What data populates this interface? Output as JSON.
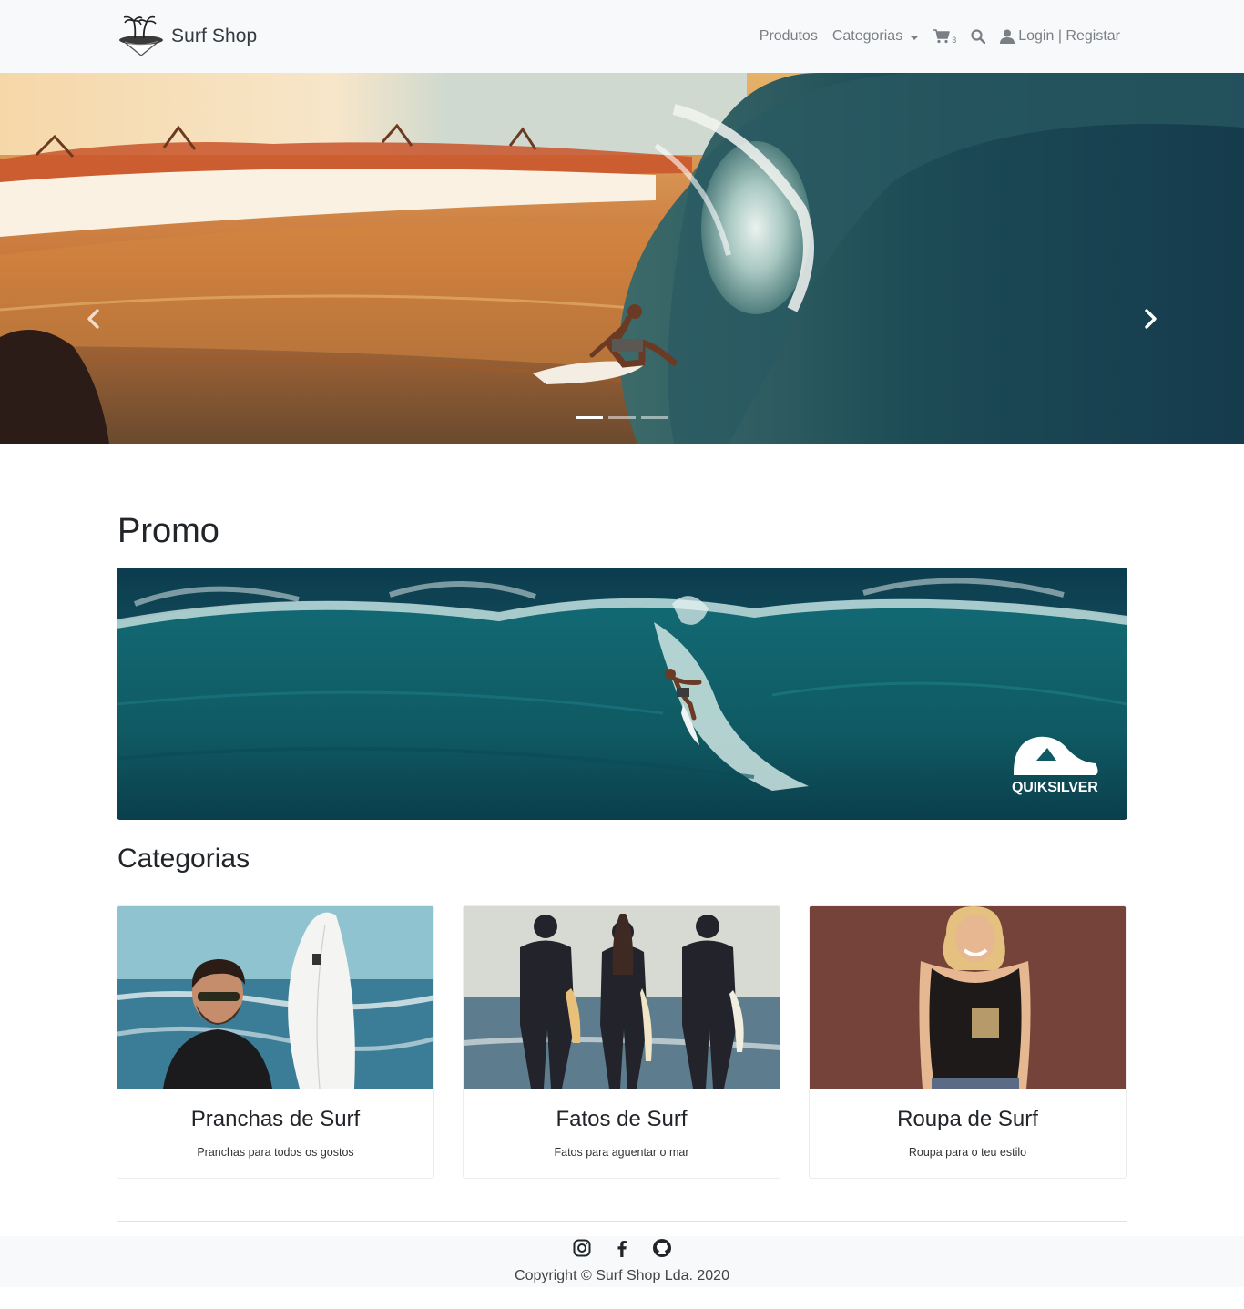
{
  "navbar": {
    "brand": "Surf Shop",
    "links": {
      "produtos": "Produtos",
      "categorias": "Categorias",
      "cart_count": "3",
      "login": "Login | Registar"
    },
    "icons": [
      "island-logo-icon",
      "caret-down-icon",
      "shopping-cart-icon",
      "search-icon",
      "user-icon"
    ]
  },
  "hero": {
    "slides": 3,
    "active_slide": 1,
    "controls": [
      "chevron-left-icon",
      "chevron-right-icon"
    ]
  },
  "promo": {
    "title": "Promo",
    "banner_brand": "QUIKSILVER"
  },
  "categories": {
    "title": "Categorias",
    "items": [
      {
        "title": "Pranchas de Surf",
        "text": "Pranchas para todos os gostos"
      },
      {
        "title": "Fatos de Surf",
        "text": "Fatos para aguentar o mar"
      },
      {
        "title": "Roupa de Surf",
        "text": "Roupa para o teu estilo"
      }
    ]
  },
  "footer": {
    "social": [
      "instagram-icon",
      "facebook-icon",
      "github-icon"
    ],
    "copyright": "Copyright © Surf Shop Lda. 2020"
  },
  "colors": {
    "navbar_bg": "#f8f9fa",
    "nav_text": "#7a7f85",
    "ocean_dark": "#0e4a55",
    "ocean_teal": "#1a6f78",
    "sunset": "#e8a24a"
  }
}
